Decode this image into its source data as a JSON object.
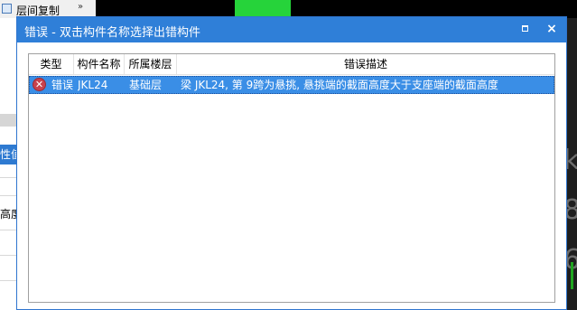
{
  "background_app": {
    "toolbar_label": "层间复制",
    "toolbar_more": "»",
    "left_highlight_text": "性值",
    "left_text": "高度"
  },
  "dialog": {
    "title": "错误 - 双击构件名称选择出错构件",
    "maximize_label": "□",
    "close_label": "×",
    "columns": [
      "类型",
      "构件名称",
      "所属楼层",
      "错误描述"
    ],
    "rows": [
      {
        "type": "错误",
        "name": "JKL24",
        "floor": "基础层",
        "description": "梁 JKL24, 第 9跨为悬挑, 悬挑端的截面高度大于支座端的截面高度"
      }
    ]
  },
  "colors": {
    "titlebar": "#2f7fd8",
    "selected_row": "#3a8ee6",
    "error_icon": "#c8424d"
  },
  "icons": {
    "row_type_icon": "error-circle-x-icon"
  }
}
